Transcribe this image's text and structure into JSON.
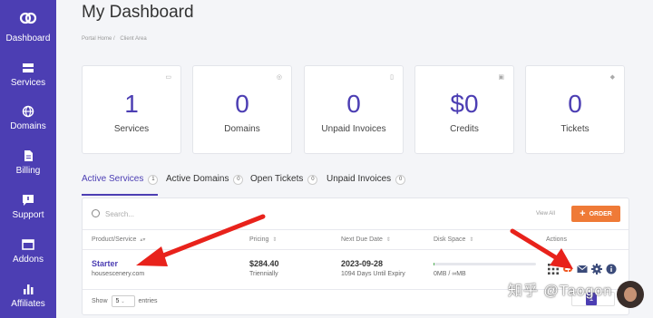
{
  "sidebar": {
    "items": [
      {
        "label": "Dashboard",
        "icon": "logo-icon"
      },
      {
        "label": "Services",
        "icon": "server-icon"
      },
      {
        "label": "Domains",
        "icon": "globe-icon"
      },
      {
        "label": "Billing",
        "icon": "document-icon"
      },
      {
        "label": "Support",
        "icon": "chat-icon"
      },
      {
        "label": "Addons",
        "icon": "window-icon"
      },
      {
        "label": "Affiliates",
        "icon": "bar-chart-icon"
      }
    ],
    "bg_color": "#4c3eb3"
  },
  "header": {
    "title": "My Dashboard",
    "breadcrumb": [
      "Portal Home /",
      "Client Area"
    ]
  },
  "tiles": [
    {
      "value": "1",
      "label": "Services",
      "icon": "server-icon"
    },
    {
      "value": "0",
      "label": "Domains",
      "icon": "globe-icon"
    },
    {
      "value": "0",
      "label": "Unpaid Invoices",
      "icon": "document-icon"
    },
    {
      "value": "$0",
      "label": "Credits",
      "icon": "card-icon"
    },
    {
      "value": "0",
      "label": "Tickets",
      "icon": "tag-icon"
    }
  ],
  "tabs": [
    {
      "label": "Active Services",
      "count": "1",
      "active": true
    },
    {
      "label": "Active Domains",
      "count": "0",
      "active": false
    },
    {
      "label": "Open Tickets",
      "count": "0",
      "active": false
    },
    {
      "label": "Unpaid Invoices",
      "count": "0",
      "active": false
    }
  ],
  "table": {
    "search_placeholder": "Search...",
    "view_all": "View All",
    "order_label": "ORDER",
    "headers": [
      "Product/Service",
      "Pricing",
      "Next Due Date",
      "Disk Space",
      "Actions"
    ],
    "rows": [
      {
        "service": "Starter",
        "domain": "housescenery.com",
        "price": "$284.40",
        "cycle": "Triennially",
        "due": "2023-09-28",
        "due_sub": "1094 Days Until Expiry",
        "disk_text": "0MB / ∞MB",
        "disk_fraction": 0.01
      }
    ],
    "show_label": "Show",
    "show_value": "5",
    "entries_label": "entries",
    "current_page": "1"
  },
  "colors": {
    "accent": "#4c3eb3",
    "order": "#ef7a37",
    "arrow": "#e8221b",
    "disk": "#4caf50"
  },
  "watermark": {
    "text": "知乎 @Taogon"
  }
}
